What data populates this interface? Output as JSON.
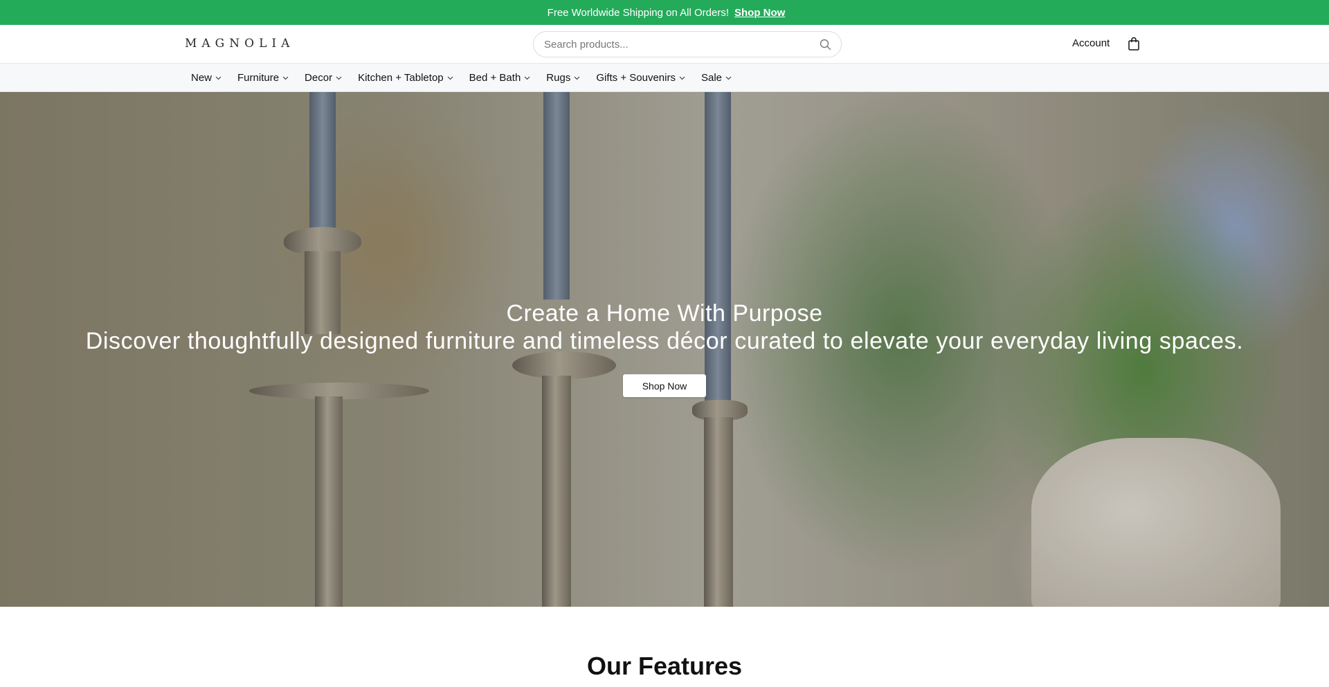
{
  "announcement": {
    "icon": "gift-icon",
    "gift_glyph": "",
    "message": "Free Worldwide Shipping on All Orders!",
    "link_label": "Shop Now",
    "close_glyph": ""
  },
  "header": {
    "logo": "MAGNOLIA",
    "search_placeholder": "Search products...",
    "account_label": "Account"
  },
  "nav": {
    "items": [
      {
        "label": "New"
      },
      {
        "label": "Furniture"
      },
      {
        "label": "Decor"
      },
      {
        "label": "Kitchen + Tabletop"
      },
      {
        "label": "Bed + Bath"
      },
      {
        "label": "Rugs"
      },
      {
        "label": "Gifts + Souvenirs"
      },
      {
        "label": "Sale"
      }
    ]
  },
  "hero": {
    "title": "Create a Home With Purpose",
    "subtitle": "Discover thoughtfully designed furniture and timeless décor curated to elevate your everyday living spaces.",
    "button_label": "Shop Now"
  },
  "features": {
    "title": "Our Features"
  },
  "colors": {
    "announcement_bg": "#23ab5a",
    "nav_bg": "#f7f8fa"
  }
}
